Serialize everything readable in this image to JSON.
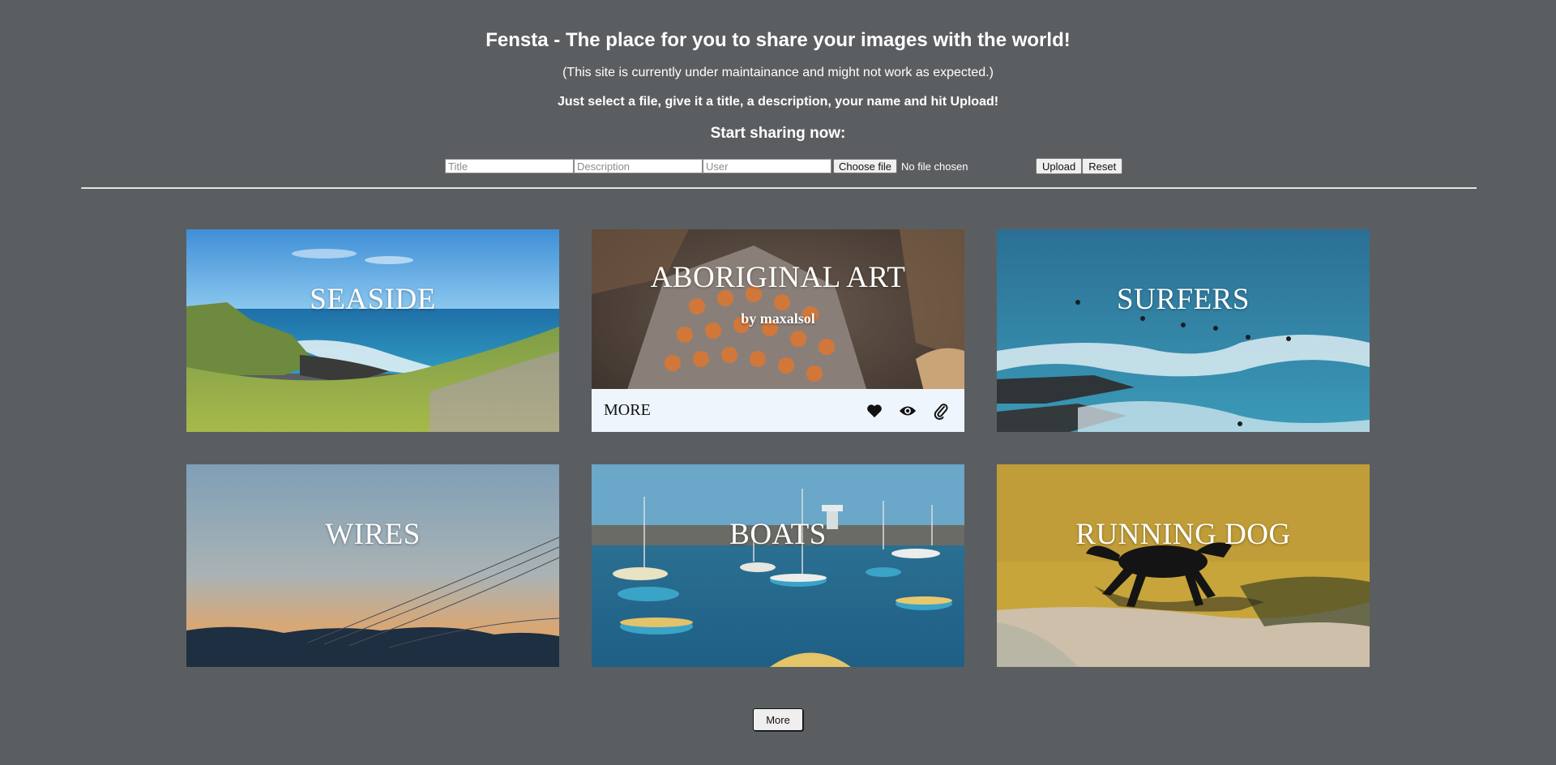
{
  "header": {
    "title": "Fensta - The place for you to share your images with the world!",
    "notice": "(This site is currently under maintainance and might not work as expected.)",
    "instructions": "Just select a file, give it a title, a description, your name and hit Upload!",
    "cta": "Start sharing now:"
  },
  "form": {
    "title_placeholder": "Title",
    "description_placeholder": "Description",
    "user_placeholder": "User",
    "choose_file_label": "Choose file",
    "file_status": "No file chosen",
    "upload_label": "Upload",
    "reset_label": "Reset"
  },
  "gallery": {
    "cards": [
      {
        "title": "SEASIDE"
      },
      {
        "title": "ABORIGINAL ART",
        "author": "by maxalsol",
        "more_label": "MORE",
        "icons": [
          "heart-icon",
          "eye-icon",
          "paperclip-icon"
        ]
      },
      {
        "title": "SURFERS"
      },
      {
        "title": "WIRES"
      },
      {
        "title": "BOATS"
      },
      {
        "title": "RUNNING DOG"
      }
    ],
    "more_button_label": "More"
  }
}
